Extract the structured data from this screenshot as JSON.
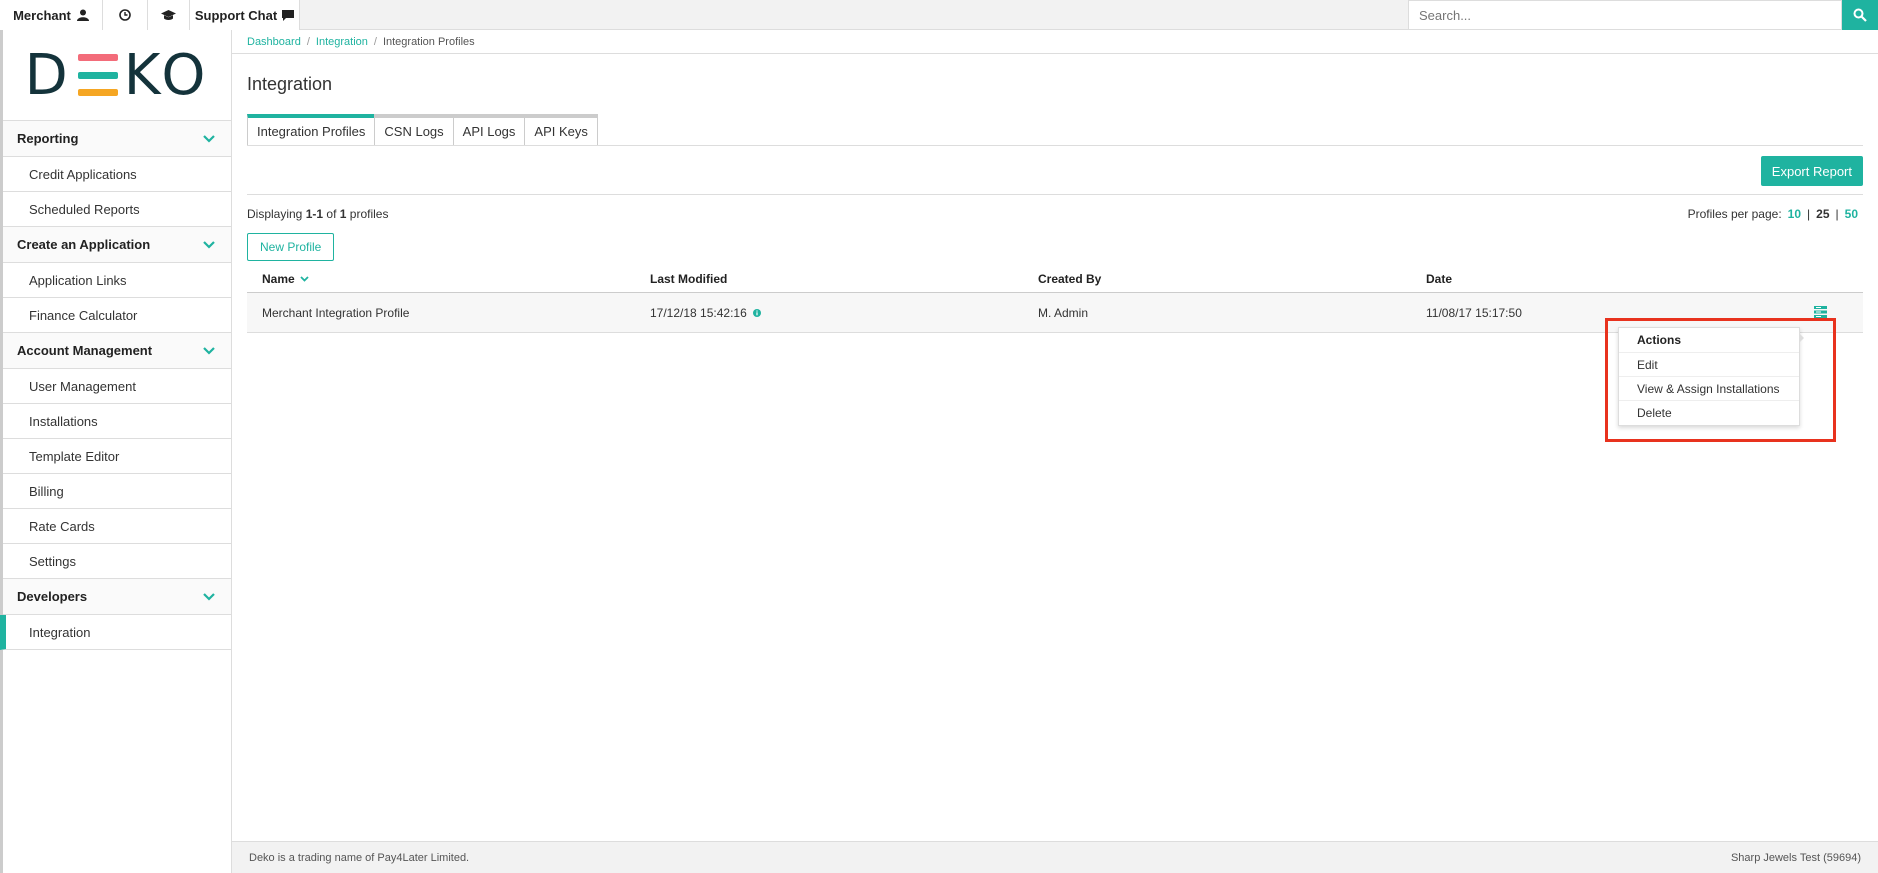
{
  "topbar": {
    "merchant_label": "Merchant",
    "support_label": "Support Chat",
    "search_placeholder": "Search..."
  },
  "sidebar": {
    "logo": "DEKO",
    "sections": [
      {
        "title": "Reporting",
        "items": [
          "Credit Applications",
          "Scheduled Reports"
        ]
      },
      {
        "title": "Create an Application",
        "items": [
          "Application Links",
          "Finance Calculator"
        ]
      },
      {
        "title": "Account Management",
        "items": [
          "User Management",
          "Installations",
          "Template Editor",
          "Billing",
          "Rate Cards",
          "Settings"
        ]
      },
      {
        "title": "Developers",
        "items": [
          "Integration"
        ]
      }
    ],
    "active_item": "Integration"
  },
  "breadcrumb": [
    "Dashboard",
    "Integration",
    "Integration Profiles"
  ],
  "page_title": "Integration",
  "tabs": [
    "Integration Profiles",
    "CSN Logs",
    "API Logs",
    "API Keys"
  ],
  "export_label": "Export Report",
  "displaying": {
    "prefix": "Displaying",
    "range": "1-1",
    "of": "of",
    "total": "1",
    "suffix": "profiles"
  },
  "perpage": {
    "label": "Profiles per page:",
    "options": [
      "10",
      "25",
      "50"
    ],
    "current": "25"
  },
  "new_profile_label": "New Profile",
  "table": {
    "headers": [
      "Name",
      "Last Modified",
      "Created By",
      "Date"
    ],
    "rows": [
      {
        "name": "Merchant Integration Profile",
        "last_modified": "17/12/18 15:42:16",
        "created_by": "M. Admin",
        "date": "11/08/17 15:17:50"
      }
    ]
  },
  "actions_menu": [
    "Actions",
    "Edit",
    "View & Assign Installations",
    "Delete"
  ],
  "footer": {
    "left": "Deko is a trading name of Pay4Later Limited.",
    "right": "Sharp Jewels Test (59694)"
  },
  "colors": {
    "accent": "#1fb3a0",
    "highlight": "#e8321e"
  }
}
